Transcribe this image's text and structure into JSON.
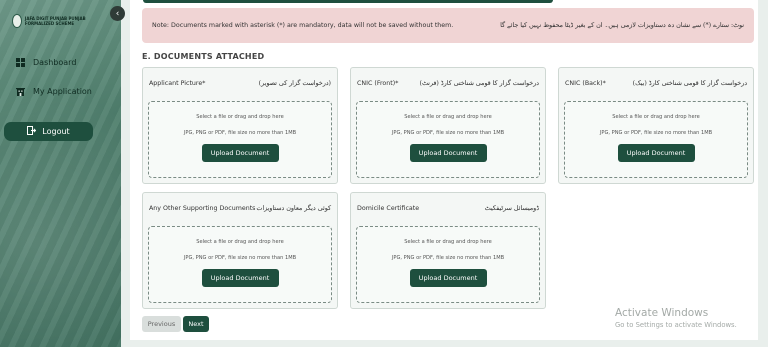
{
  "sidebar": {
    "logo_text": "JAFA DIGIT PUNJAB PUNJAB FORMALIZED SCHEME",
    "items": [
      {
        "label": "Dashboard",
        "icon": "grid-icon"
      },
      {
        "label": "My Application",
        "icon": "building-icon"
      }
    ],
    "logout_label": "Logout",
    "collapse_icon": "chevron-left-icon"
  },
  "notice": {
    "english": "Note: Documents marked with asterisk (*) are mandatory, data will not be saved without them.",
    "urdu": "نوٹ: ستارے (*) سے نشان دہ دستاویزات لازمی ہیں۔ ان کے بغیر ڈیٹا محفوظ نہیں کیا جائے گا"
  },
  "section": {
    "title": "E. DOCUMENTS ATTACHED"
  },
  "documents": [
    {
      "label": "Applicant Picture*",
      "label_ur": "(درخواست گزار کی تصویر)"
    },
    {
      "label": "CNIC (Front)*",
      "label_ur": "درخواست گزار کا قومی شناختی کارڈ (فرنٹ)"
    },
    {
      "label": "CNIC (Back)*",
      "label_ur": "درخواست گزار کا قومی شناختی کارڈ (بیک)"
    },
    {
      "label": "Any Other Supporting Documents",
      "label_ur": "کوئی دیگر معاون دستاویزات"
    },
    {
      "label": "Domicile Certificate",
      "label_ur": "ڈومیسائل سرٹیفکیٹ"
    }
  ],
  "upload": {
    "instruction": "Select a file or drag and drop here",
    "formats": "JPG, PNG or PDF, file size no more than 1MB",
    "button": "Upload Document"
  },
  "navigation": {
    "previous": "Previous",
    "next": "Next"
  },
  "watermark": {
    "line1": "Activate Windows",
    "line2": "Go to Settings to activate Windows."
  },
  "colors": {
    "primary": "#1e4f3e",
    "notice_bg": "#f0d4d4",
    "sidebar": "#4f7f6d"
  }
}
